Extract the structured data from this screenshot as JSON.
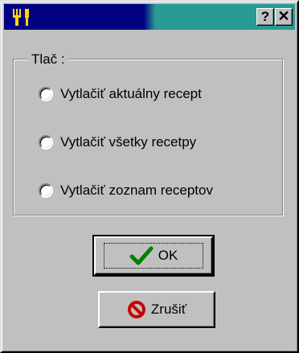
{
  "window": {
    "titlebar_colors": {
      "left": "#000080",
      "right": "#2a9a94"
    },
    "app_icon": "fork-knife-icon",
    "help_button": "?",
    "close_button": "✕"
  },
  "print_group": {
    "label": "Tlač :",
    "options": [
      {
        "label": "Vytlačiť aktuálny recept",
        "selected": false
      },
      {
        "label": "Vytlačiť všetky recetpy",
        "selected": false
      },
      {
        "label": "Vytlačiť zoznam receptov",
        "selected": false
      }
    ]
  },
  "buttons": {
    "ok_label": "OK",
    "ok_icon": "checkmark-icon",
    "cancel_label": "Zrušiť",
    "cancel_icon": "no-entry-icon"
  }
}
